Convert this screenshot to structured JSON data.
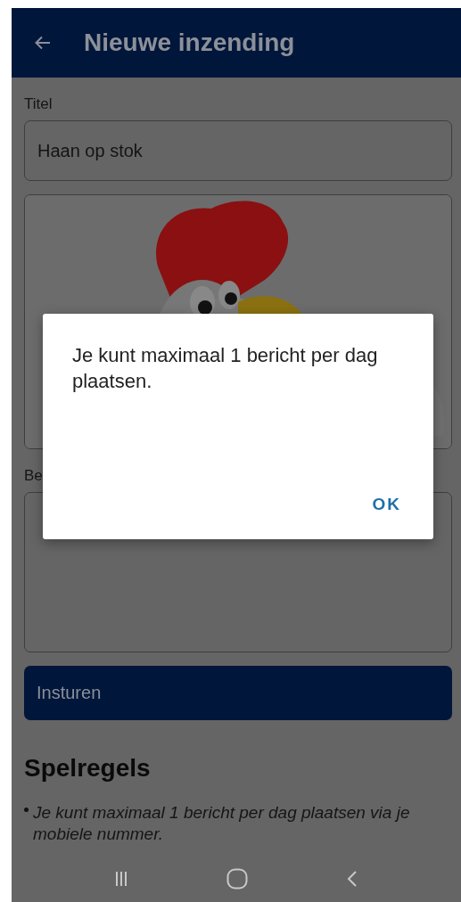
{
  "app_bar": {
    "title": "Nieuwe inzending"
  },
  "form": {
    "title_label": "Titel",
    "title_value": "Haan op stok",
    "description_label": "Be",
    "submit": "Insturen"
  },
  "rules": {
    "heading": "Spelregels",
    "items": [
      "Je kunt maximaal 1 bericht per dag plaatsen via je mobiele nummer."
    ]
  },
  "dialog": {
    "message": "Je kunt maximaal 1 bericht per dag plaatsen.",
    "buttons": [
      "OK"
    ]
  }
}
